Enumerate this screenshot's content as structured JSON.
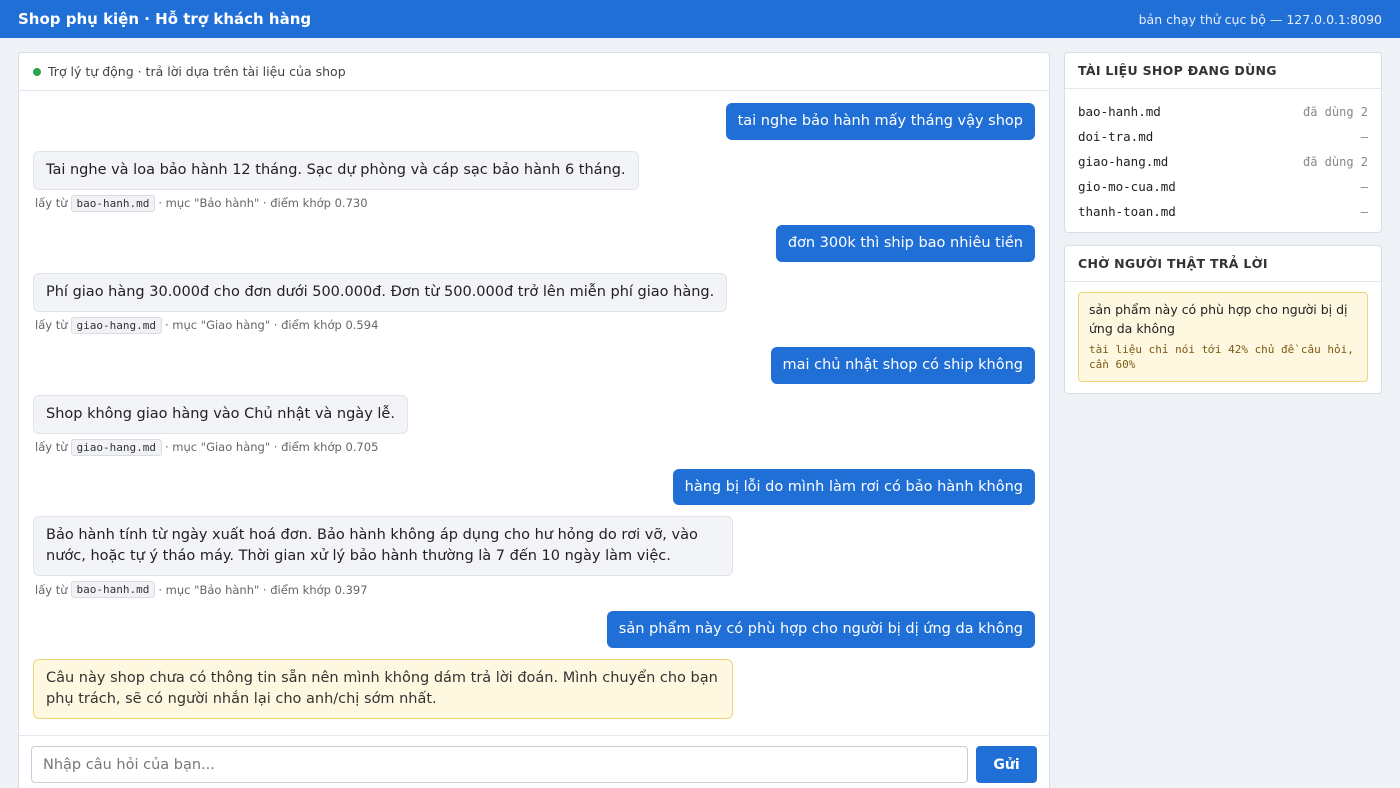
{
  "header": {
    "title": "Shop phụ kiện · Hỗ trợ khách hàng",
    "env": "bản chạy thử cục bộ — 127.0.0.1:8090"
  },
  "chat": {
    "status": "Trợ lý tự động · trả lời dựa trên tài liệu của shop",
    "messages": [
      {
        "user": "tai nghe bảo hành mấy tháng vậy shop",
        "bot": "Tai nghe và loa bảo hành 12 tháng. Sạc dự phòng và cáp sạc bảo hành 6 tháng.",
        "src_prefix": "lấy từ",
        "src_file": "bao-hanh.md",
        "src_rest": "· mục \"Bảo hành\" · điểm khớp 0.730"
      },
      {
        "user": "đơn 300k thì ship bao nhiêu tiền",
        "bot": "Phí giao hàng 30.000đ cho đơn dưới 500.000đ. Đơn từ 500.000đ trở lên miễn phí giao hàng.",
        "src_prefix": "lấy từ",
        "src_file": "giao-hang.md",
        "src_rest": "· mục \"Giao hàng\" · điểm khớp 0.594"
      },
      {
        "user": "mai chủ nhật shop có ship không",
        "bot": "Shop không giao hàng vào Chủ nhật và ngày lễ.",
        "src_prefix": "lấy từ",
        "src_file": "giao-hang.md",
        "src_rest": "· mục \"Giao hàng\" · điểm khớp 0.705"
      },
      {
        "user": "hàng bị lỗi do mình làm rơi có bảo hành không",
        "bot": "Bảo hành tính từ ngày xuất hoá đơn. Bảo hành không áp dụng cho hư hỏng do rơi vỡ, vào nước, hoặc tự ý tháo máy. Thời gian xử lý bảo hành thường là 7 đến 10 ngày làm việc.",
        "src_prefix": "lấy từ",
        "src_file": "bao-hanh.md",
        "src_rest": "· mục \"Bảo hành\" · điểm khớp 0.397"
      },
      {
        "user": "sản phẩm này có phù hợp cho người bị dị ứng da không",
        "bot": "Câu này shop chưa có thông tin sẵn nên mình không dám trả lời đoán. Mình chuyển cho bạn phụ trách, sẽ có người nhắn lại cho anh/chị sớm nhất."
      }
    ],
    "input_placeholder": "Nhập câu hỏi của bạn...",
    "send_label": "Gửi"
  },
  "docs_panel": {
    "title": "TÀI LIỆU SHOP ĐANG DÙNG",
    "docs": [
      {
        "name": "bao-hanh.md",
        "usage": "đã dùng 2"
      },
      {
        "name": "doi-tra.md",
        "usage": "—"
      },
      {
        "name": "giao-hang.md",
        "usage": "đã dùng 2"
      },
      {
        "name": "gio-mo-cua.md",
        "usage": "—"
      },
      {
        "name": "thanh-toan.md",
        "usage": "—"
      }
    ]
  },
  "wait_panel": {
    "title": "CHỜ NGƯỜI THẬT TRẢ LỜI",
    "item": {
      "question": "sản phẩm này có phù hợp cho người bị dị ứng da không",
      "reason": "tài liệu chỉ nói tới 42% chủ đề câu hỏi, cần 60%"
    }
  },
  "colors": {
    "accent": "#1f6fd6",
    "warn_bg": "#fff8e1",
    "status_dot": "#2aa34a"
  }
}
